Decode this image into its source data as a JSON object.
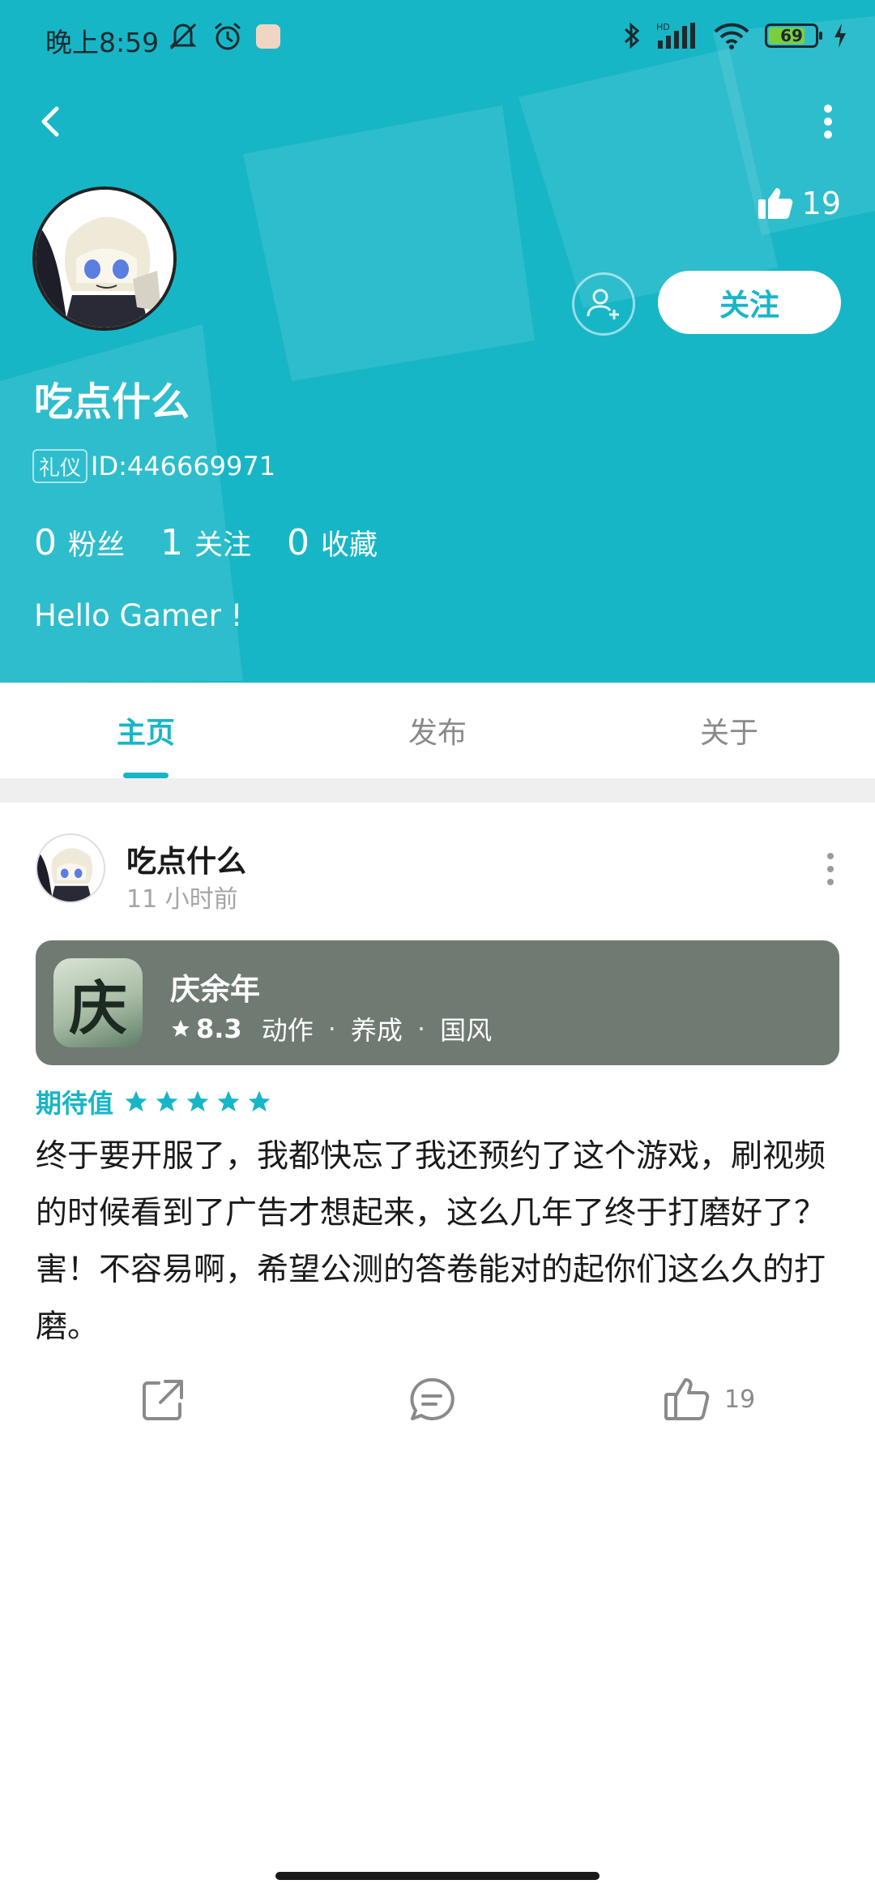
{
  "status_bar": {
    "time": "晚上8:59",
    "battery": "69"
  },
  "profile": {
    "like_count": "19",
    "username": "吃点什么",
    "tag": "礼仪",
    "id_text": "ID:446669971",
    "stats": [
      {
        "num": "0",
        "label": "粉丝"
      },
      {
        "num": "1",
        "label": "关注"
      },
      {
        "num": "0",
        "label": "收藏"
      }
    ],
    "bio": "Hello Gamer !",
    "follow_label": "关注"
  },
  "tabs": [
    {
      "label": "主页",
      "active": true
    },
    {
      "label": "发布",
      "active": false
    },
    {
      "label": "关于",
      "active": false
    }
  ],
  "post": {
    "author": "吃点什么",
    "time": "11 小时前",
    "game": {
      "title": "庆余年",
      "rating": "8.3",
      "tags": [
        "动作",
        "养成",
        "国风"
      ],
      "icon_glyph": "庆"
    },
    "expect_label": "期待值",
    "expect_stars": 5,
    "body": "终于要开服了，我都快忘了我还预约了这个游戏，刷视频的时候看到了广告才想起来，这么几年了终于打磨好了？害！不容易啊，希望公测的答卷能对的起你们这么久的打磨。",
    "like_count": "19"
  },
  "colors": {
    "accent": "#17b6c7",
    "game_card": "#6f7a72"
  }
}
